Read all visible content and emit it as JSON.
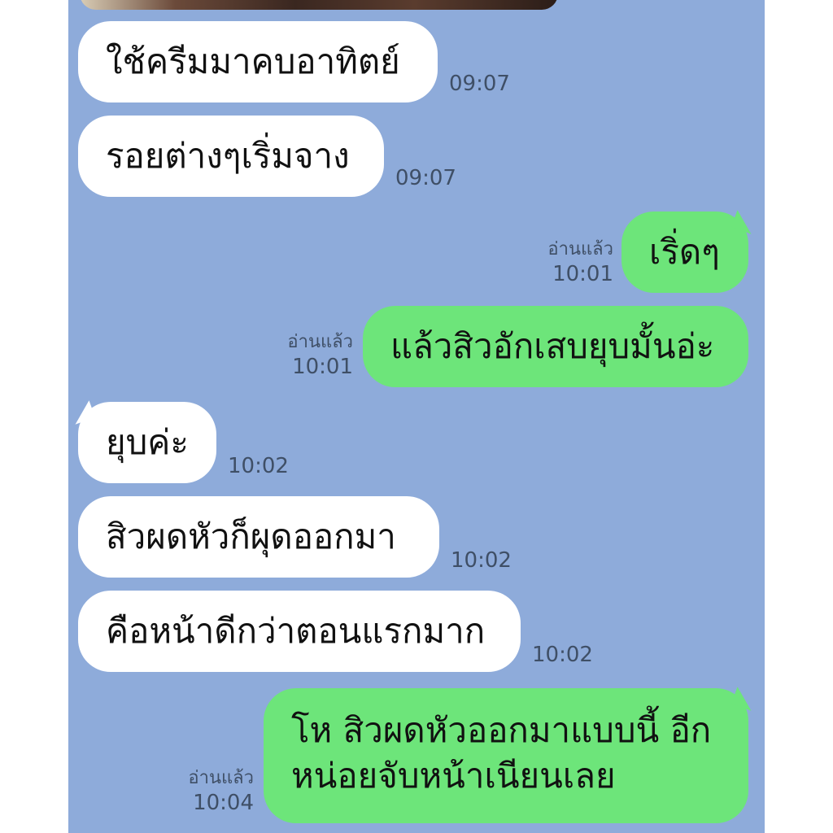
{
  "messages": [
    {
      "side": "in",
      "text": "ใช้ครีมมาคบอาทิตย์",
      "time": "09:07"
    },
    {
      "side": "in",
      "text": "รอยต่างๆเริ่มจาง",
      "time": "09:07"
    },
    {
      "side": "out",
      "text": "เริ่ดๆ",
      "time": "10:01",
      "status": "อ่านแล้ว"
    },
    {
      "side": "out",
      "text": "แล้วสิวอักเสบยุบมั้นอ่ะ",
      "time": "10:01",
      "status": "อ่านแล้ว"
    },
    {
      "side": "in",
      "text": "ยุบค่ะ",
      "time": "10:02"
    },
    {
      "side": "in",
      "text": "สิวผดหัวก็ผุดออกมา",
      "time": "10:02"
    },
    {
      "side": "in",
      "text": "คือหน้าดีกว่าตอนแรกมาก",
      "time": "10:02"
    },
    {
      "side": "out",
      "text": "โห สิวผดหัวออกมาแบบนี้ อีกหน่อยจับหน้าเนียนเลย",
      "time": "10:04",
      "status": "อ่านแล้ว"
    }
  ]
}
